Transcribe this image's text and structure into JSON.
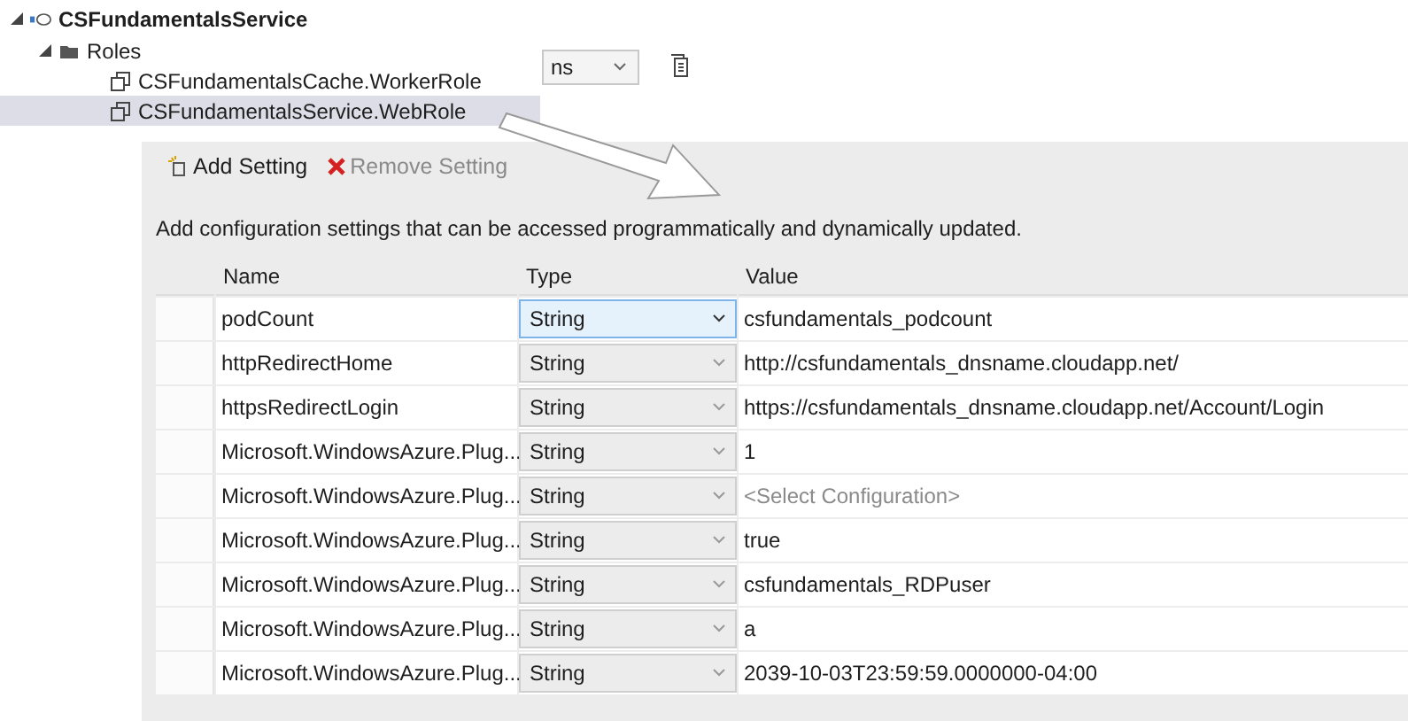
{
  "tree": {
    "label": "CSFundamentalsService",
    "expanded": true,
    "children": [
      {
        "label": "Roles",
        "expanded": true,
        "children": [
          {
            "label": "CSFundamentalsCache.WorkerRole",
            "selected": false
          },
          {
            "label": "CSFundamentalsService.WebRole",
            "selected": true
          }
        ]
      }
    ]
  },
  "config_dropdown": {
    "value": "ns"
  },
  "toolbar": {
    "add_setting": "Add Setting",
    "remove_setting": "Remove Setting"
  },
  "description": "Add configuration settings that can be accessed programmatically and dynamically updated.",
  "table": {
    "columns": [
      "Name",
      "Type",
      "Value"
    ],
    "rows": [
      {
        "name": "podCount",
        "type": "String",
        "value": "csfundamentals_podcount",
        "selected": true
      },
      {
        "name": "httpRedirectHome",
        "type": "String",
        "value": "http://csfundamentals_dnsname.cloudapp.net/",
        "selected": false
      },
      {
        "name": "httpsRedirectLogin",
        "type": "String",
        "value": "https://csfundamentals_dnsname.cloudapp.net/Account/Login",
        "selected": false
      },
      {
        "name": "Microsoft.WindowsAzure.Plug...",
        "type": "String",
        "value": "1",
        "selected": false
      },
      {
        "name": "Microsoft.WindowsAzure.Plug...",
        "type": "String",
        "placeholder": "<Select Configuration>",
        "selected": false
      },
      {
        "name": "Microsoft.WindowsAzure.Plug...",
        "type": "String",
        "value": "true",
        "selected": false
      },
      {
        "name": "Microsoft.WindowsAzure.Plug...",
        "type": "String",
        "value": "csfundamentals_RDPuser",
        "selected": false
      },
      {
        "name": "Microsoft.WindowsAzure.Plug...",
        "type": "String",
        "value": "a",
        "selected": false
      },
      {
        "name": "Microsoft.WindowsAzure.Plug...",
        "type": "String",
        "value": "2039-10-03T23:59:59.0000000-04:00",
        "selected": false
      }
    ]
  }
}
